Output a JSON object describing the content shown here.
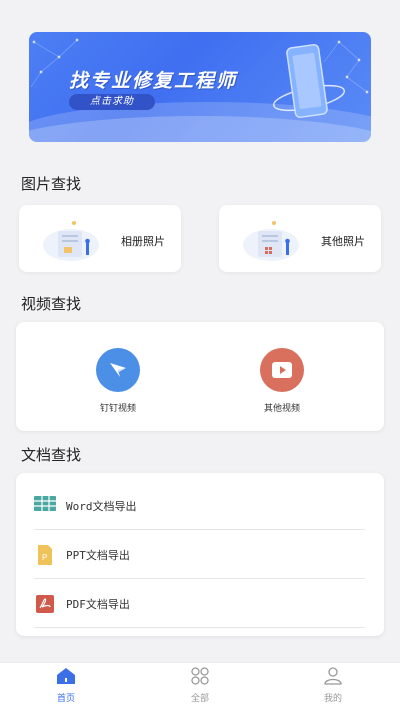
{
  "banner": {
    "title": "找专业修复工程师",
    "button_label": "点击求助"
  },
  "sections": {
    "photo_title": "图片查找",
    "video_title": "视频查找",
    "docs_title": "文档查找"
  },
  "photo_cards": [
    {
      "label": "相册照片"
    },
    {
      "label": "其他照片"
    }
  ],
  "video_items": [
    {
      "label": "钉钉视频",
      "color": "#4c8fe6"
    },
    {
      "label": "其他视频",
      "color": "#d9705e"
    }
  ],
  "doc_items": [
    {
      "label": "Word文档导出",
      "color": "#4aa8a3"
    },
    {
      "label": "PPT文档导出",
      "color": "#f0c35a"
    },
    {
      "label": "PDF文档导出",
      "color": "#cf5a4c"
    }
  ],
  "tabs": [
    {
      "label": "首页",
      "active": true,
      "color": "#3a6fe8"
    },
    {
      "label": "全部",
      "active": false,
      "color": "#999999"
    },
    {
      "label": "我的",
      "active": false,
      "color": "#999999"
    }
  ],
  "icons": {
    "home": "home-icon",
    "grid": "grid-icon",
    "user": "user-icon",
    "paper_plane": "paper-plane-icon",
    "play": "play-icon"
  }
}
